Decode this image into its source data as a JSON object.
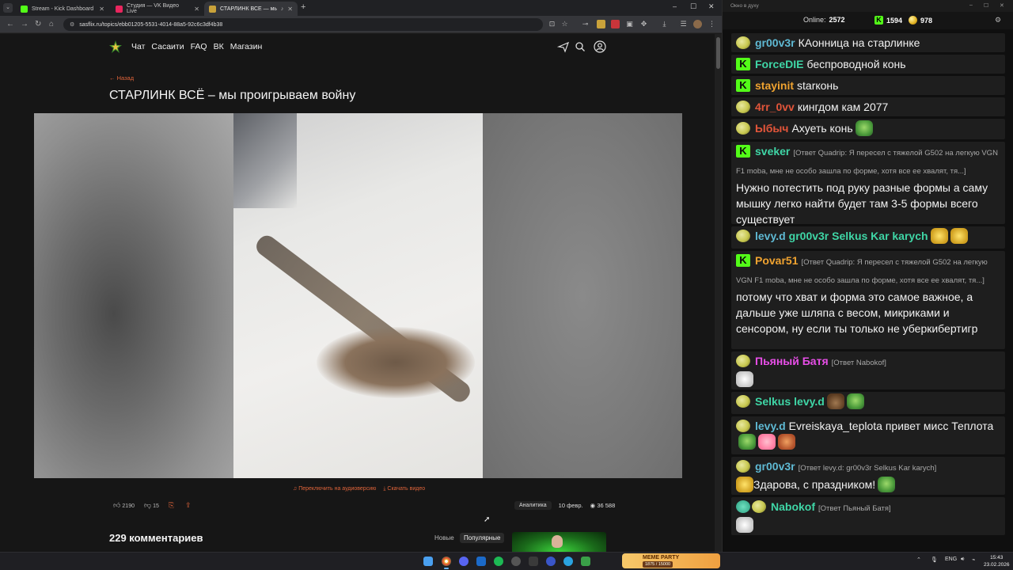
{
  "browser": {
    "tabs": [
      {
        "label": "Stream - Kick Dashboard"
      },
      {
        "label": "Студия — VK Видео Live"
      },
      {
        "label": "СТАРЛИНК ВСЁ — мы про"
      }
    ],
    "url": "sasflix.ru/topics/ebb01205-5531-4014-88a5-92c6c3df4b38"
  },
  "site": {
    "nav": [
      "Чат",
      "Сасаити",
      "FAQ",
      "ВК",
      "Магазин"
    ],
    "back_label": "← Назад",
    "title": "СТАРЛИНК ВСЁ – мы проигрываем войну",
    "video_links": {
      "audio": "Переключить на аудиоверсию",
      "download": "Скачать видео"
    },
    "likes": "2190",
    "dislikes": "15",
    "tag": "Аналитика",
    "date": "10 февр.",
    "views": "36 588",
    "comments_title": "229 комментариев",
    "sort_new": "Новые",
    "sort_popular": "Популярные"
  },
  "chat": {
    "window_title": "Окно в духу",
    "online_label": "Online:",
    "online_count": "2572",
    "kick_count": "1594",
    "coin_count": "978",
    "messages": [
      {
        "user": "gr00v3r",
        "text": "КАонница на старлинке"
      },
      {
        "user": "ForceDIE",
        "text": "беспроводной конь"
      },
      {
        "user": "stayinit",
        "text": "starконь"
      },
      {
        "user": "4rr_0vv",
        "text": "кингдом кам 2077"
      },
      {
        "user": "Ыбыч",
        "text": "Ахуеть конь"
      },
      {
        "user": "sveker",
        "reply": "[Ответ Quadrip: Я пересел с тяжелой G502 на легкую VGN F1 moba, мне не особо зашла по форме, хотя все ее хвалят, тя...]",
        "text": "Нужно потестить под руку разные формы а саму мышку легко найти будет там 3-5 формы всего существует"
      },
      {
        "user": "levy.d",
        "text": "gr00v3r Selkus Kar karych"
      },
      {
        "user": "Povar51",
        "reply": "[Ответ Quadrip: Я пересел с тяжелой G502 на легкую VGN F1 moba, мне не особо зашла по форме, хотя все ее хвалят, тя...]",
        "text": "потому что хват и форма это самое важное, а дальше уже шляпа с весом, микриками и сенсором, ну если ты только не уберкибертигр"
      },
      {
        "user": "Пьяный Батя",
        "reply": "[Ответ Nabokof]",
        "text": ""
      },
      {
        "user": "Selkus",
        "text": "levy.d"
      },
      {
        "user": "levy.d",
        "text": "Evreiskaya_teplota привет мисс Теплота"
      },
      {
        "user": "gr00v3r",
        "reply": "[Ответ levy.d: gr00v3r Selkus Kar karych]",
        "text": "Здарова, с праздником!"
      },
      {
        "user": "Nabokof",
        "reply": "[Ответ Пьяный Батя]",
        "text": ""
      }
    ]
  },
  "taskbar": {
    "meme_title": "MEME PARTY",
    "meme_progress": "1875 / 15000",
    "lang": "ENG",
    "time": "15:43",
    "date": "23.02.2026"
  },
  "colors": {
    "accent": "#e0643a",
    "kick_green": "#53fc18"
  }
}
